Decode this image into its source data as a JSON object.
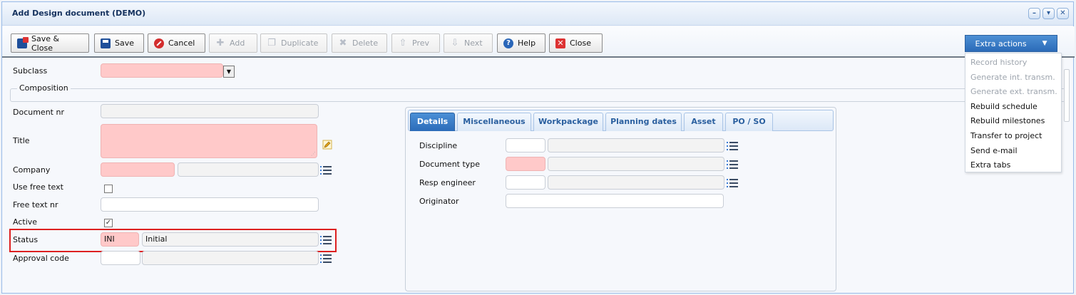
{
  "window": {
    "title": "Add Design document (DEMO)",
    "tools": [
      "–",
      "▾",
      "✕"
    ]
  },
  "toolbar": {
    "save_close": "Save & Close",
    "save": "Save",
    "cancel": "Cancel",
    "add": "Add",
    "duplicate": "Duplicate",
    "delete": "Delete",
    "prev": "Prev",
    "next": "Next",
    "help": "Help",
    "close": "Close"
  },
  "extra_actions": {
    "label": "Extra actions",
    "items": [
      {
        "label": "Record history",
        "enabled": false
      },
      {
        "label": "Generate int. transm.",
        "enabled": false
      },
      {
        "label": "Generate ext. transm.",
        "enabled": false
      },
      {
        "label": "Rebuild schedule",
        "enabled": true
      },
      {
        "label": "Rebuild milestones",
        "enabled": true
      },
      {
        "label": "Transfer to project",
        "enabled": true
      },
      {
        "label": "Send e-mail",
        "enabled": true
      },
      {
        "label": "Extra tabs",
        "enabled": true
      }
    ]
  },
  "form": {
    "subclass_label": "Subclass",
    "composition_label": "Composition",
    "document_nr_label": "Document nr",
    "title_label": "Title",
    "company_label": "Company",
    "use_free_text_label": "Use free text",
    "free_text_nr_label": "Free text nr",
    "active_label": "Active",
    "active_checked": true,
    "status_label": "Status",
    "status_code": "INI",
    "status_desc": "Initial",
    "approval_code_label": "Approval code"
  },
  "tabs": [
    "Details",
    "Miscellaneous",
    "Workpackage",
    "Planning dates",
    "Asset",
    "PO / SO"
  ],
  "details": {
    "discipline_label": "Discipline",
    "document_type_label": "Document type",
    "resp_engineer_label": "Resp engineer",
    "originator_label": "Originator"
  },
  "colors": {
    "required_field": "#ffc9c9",
    "accent": "#2c6cb9",
    "highlight": "#dd2020"
  }
}
